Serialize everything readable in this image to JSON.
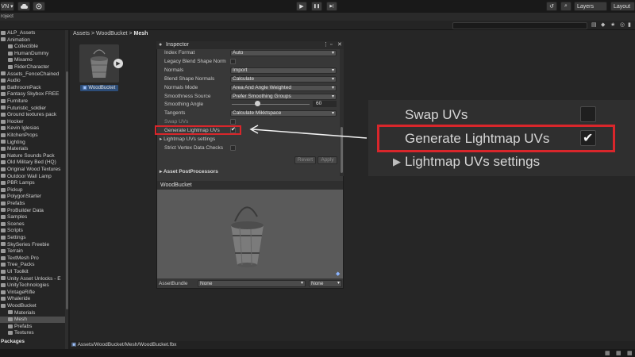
{
  "toolbar": {
    "account_label": "VN ▾",
    "cloud_icon": "cloud-icon",
    "collab_icon": "collab-icon",
    "play_glyph": "▶",
    "pause_glyph": "❚❚",
    "step_glyph": "▶|",
    "history_glyph": "↺",
    "search_glyph": "⌕",
    "layers_label": "Layers",
    "layout_label": "Layout"
  },
  "project_bar": {
    "label": "roject"
  },
  "tree": {
    "rows": [
      {
        "label": "ALP_Assets",
        "indent": 0
      },
      {
        "label": "Animation",
        "indent": 0
      },
      {
        "label": "Collectible",
        "indent": 1
      },
      {
        "label": "HumanDummy",
        "indent": 1
      },
      {
        "label": "Mixamo",
        "indent": 1
      },
      {
        "label": "RiderCharacter",
        "indent": 1
      },
      {
        "label": "Assets_FenceChained",
        "indent": 0
      },
      {
        "label": "Audio",
        "indent": 0
      },
      {
        "label": "BathroomPack",
        "indent": 0
      },
      {
        "label": "Fantasy Skybox FREE",
        "indent": 0
      },
      {
        "label": "Furniture",
        "indent": 0
      },
      {
        "label": "Futuristic_soldier",
        "indent": 0
      },
      {
        "label": "Ground textures pack",
        "indent": 0
      },
      {
        "label": "Hocker",
        "indent": 0
      },
      {
        "label": "Kevin Iglesias",
        "indent": 0
      },
      {
        "label": "KitchenProps",
        "indent": 0
      },
      {
        "label": "Lighting",
        "indent": 0
      },
      {
        "label": "Materials",
        "indent": 0
      },
      {
        "label": "Nature Sounds Pack",
        "indent": 0
      },
      {
        "label": "Old Military Bed (HQ)",
        "indent": 0
      },
      {
        "label": "Original Wood Textures",
        "indent": 0
      },
      {
        "label": "Outdoor Wall Lamp",
        "indent": 0
      },
      {
        "label": "PBR Lamps",
        "indent": 0
      },
      {
        "label": "Pickup",
        "indent": 0
      },
      {
        "label": "PolygonStarter",
        "indent": 0
      },
      {
        "label": "Prefabs",
        "indent": 0
      },
      {
        "label": "ProBuilder Data",
        "indent": 0
      },
      {
        "label": "Samples",
        "indent": 0
      },
      {
        "label": "Scenes",
        "indent": 0
      },
      {
        "label": "Scripts",
        "indent": 0
      },
      {
        "label": "Settings",
        "indent": 0
      },
      {
        "label": "SkySeries Freebie",
        "indent": 0
      },
      {
        "label": "Terrain",
        "indent": 0
      },
      {
        "label": "TextMesh Pro",
        "indent": 0
      },
      {
        "label": "Tree_Packs",
        "indent": 0
      },
      {
        "label": "UI Toolkit",
        "indent": 0
      },
      {
        "label": "Unity Asset Unlocks - E",
        "indent": 0
      },
      {
        "label": "UnityTechnologies",
        "indent": 0
      },
      {
        "label": "VintageRifle",
        "indent": 0
      },
      {
        "label": "Whaleride",
        "indent": 0
      },
      {
        "label": "WoodBucket",
        "indent": 0
      },
      {
        "label": "Materials",
        "indent": 1
      },
      {
        "label": "Mesh",
        "indent": 1,
        "selected": true
      },
      {
        "label": "Prefabs",
        "indent": 1
      },
      {
        "label": "Textures",
        "indent": 1
      }
    ],
    "packages_label": "Packages"
  },
  "breadcrumb": {
    "part1": "Assets",
    "sep": " > ",
    "part2": "WoodBucket",
    "part3": "Mesh"
  },
  "asset": {
    "label": "WoodBucket"
  },
  "inspector": {
    "title": "Inspector",
    "rows": {
      "index_format": "Index Format",
      "legacy_blend": "Legacy Blend Shape Norm",
      "normals": "Normals",
      "blend_normals": "Blend Shape Normals",
      "normals_mode": "Normals Mode",
      "smoothness_source": "Smoothness Source",
      "smoothing_angle": "Smoothing Angle",
      "tangents": "Tangents",
      "swap_uvs": "Swap UVs",
      "gen_lightmap": "Generate Lightmap UVs",
      "lightmap_settings": "Lightmap UVs settings",
      "strict_vertex": "Strict Vertex Data Checks",
      "asset_postprocessors": "Asset PostProcessors"
    },
    "values": {
      "index_format": "Auto",
      "normals": "Import",
      "blend_normals": "Calculate",
      "normals_mode": "Area And Angle Weighted",
      "smoothness_source": "Prefer Smoothing Groups",
      "smoothing_angle": "60",
      "smoothing_angle_fraction": 0.33,
      "tangents": "Calculate Mikktspace"
    },
    "revert_label": "Revert",
    "apply_label": "Apply",
    "preview_title": "WoodBucket",
    "assetbundle_label": "AssetBundle",
    "assetbundle_value": "None",
    "assetbundle_variant": "None"
  },
  "zoom": {
    "swap_uvs": "Swap UVs",
    "gen_lightmap": "Generate Lightmap UVs",
    "lightmap_settings": "Lightmap UVs settings"
  },
  "pathbar": {
    "path": "Assets/WoodBucket/Mesh/WoodBucket.fbx"
  },
  "colors": {
    "highlight": "#d9262b",
    "selection": "#2d4d78"
  }
}
